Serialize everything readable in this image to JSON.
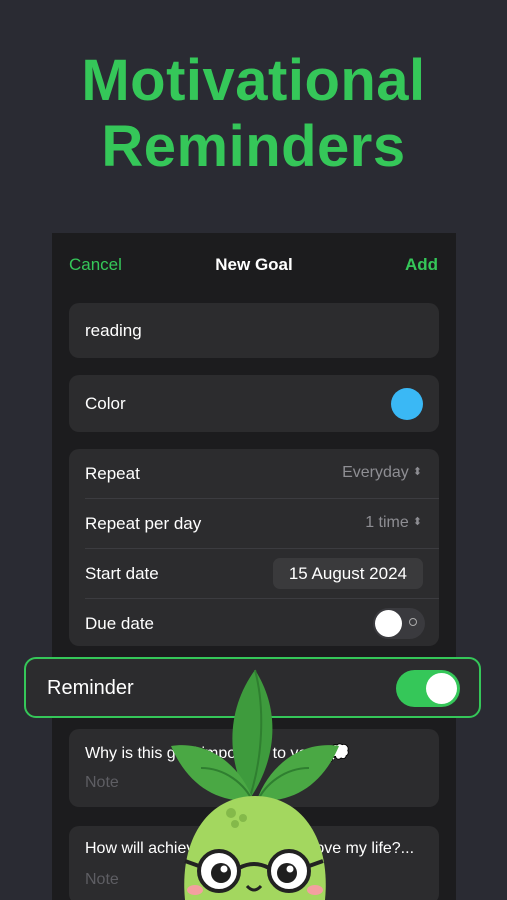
{
  "headline": {
    "line1": "Motivational",
    "line2": "Reminders"
  },
  "navbar": {
    "cancel": "Cancel",
    "title": "New Goal",
    "add": "Add"
  },
  "goal_name": "reading",
  "color_row": {
    "label": "Color",
    "color": "#3ab8f5"
  },
  "settings": {
    "repeat": {
      "label": "Repeat",
      "value": "Everyday"
    },
    "repeat_per_day": {
      "label": "Repeat per day",
      "value": "1 time"
    },
    "start_date": {
      "label": "Start date",
      "value": "15 August 2024"
    },
    "due_date": {
      "label": "Due date",
      "enabled": false
    }
  },
  "reminder": {
    "label": "Reminder",
    "enabled": true
  },
  "questions": [
    {
      "title": "Why is this goal important to you? 💭",
      "placeholder": "Note"
    },
    {
      "title": "How will achieving this goal improve my life?...",
      "placeholder": "Note"
    }
  ],
  "colors": {
    "accent": "#35c759",
    "background": "#2a2b33",
    "card": "#2c2c2e",
    "panel": "#1c1c1e"
  },
  "icons": {
    "chevron": "chevron-up-down-icon",
    "mascot": "pineapple-mascot"
  }
}
